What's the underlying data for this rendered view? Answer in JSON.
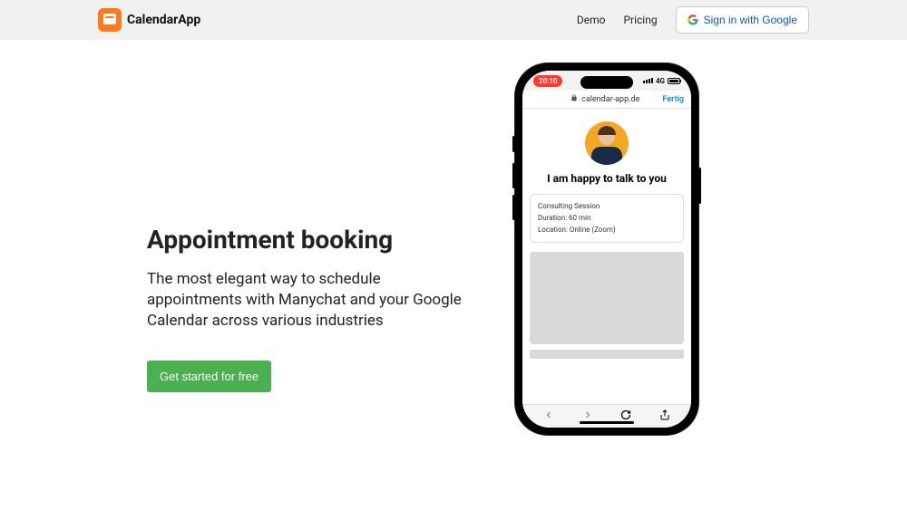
{
  "header": {
    "brand_name": "CalendarApp",
    "nav": {
      "demo": "Demo",
      "pricing": "Pricing",
      "signin": "Sign in with Google"
    }
  },
  "hero": {
    "title": "Appointment booking",
    "subtitle": "The most elegant way to schedule appointments with Manychat and your Google Calendar across various industries",
    "cta": "Get started for free"
  },
  "phone": {
    "status": {
      "time": "20:10",
      "network": "4G"
    },
    "urlbar": {
      "domain": "calendar-app.de",
      "done": "Fertig"
    },
    "page": {
      "headline": "I am happy to talk to you",
      "session_title": "Consulting Session",
      "duration": "Duration: 60 min",
      "location": "Location: Online (Zoom)"
    }
  }
}
